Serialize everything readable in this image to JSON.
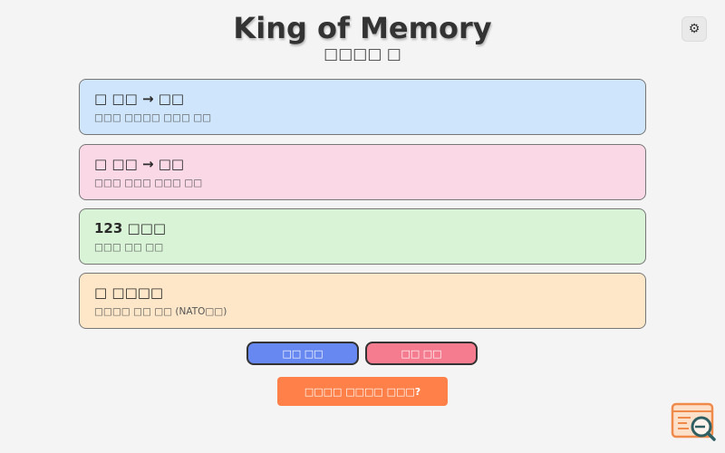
{
  "header": {
    "title": "King of Memory",
    "subtitle": "□□□□ □",
    "settings_icon": "⚙"
  },
  "cards": [
    {
      "title": "□ □□ → □□",
      "desc": "□□□ □□□□ □□□ □□"
    },
    {
      "title": "□ □□ → □□",
      "desc": "□□□ □□□ □□□ □□"
    },
    {
      "title": "123 □□□",
      "desc": "□□□ □□ □□"
    },
    {
      "title": "□ □□□□",
      "desc": "□□□□ □□ □□ (NATO□□)"
    }
  ],
  "buttons": {
    "blue_label": "□□ □□",
    "pink_label": "□□ □□",
    "orange_label": "□□□□ □□□□ □□□?"
  },
  "colors": {
    "card1": "#cfe5fb",
    "card2": "#fbd8e6",
    "card3": "#d9f3d6",
    "card4": "#fde7c8",
    "blue_button": "#6688f0",
    "pink_button": "#f57b8f",
    "orange_button": "#ff8149"
  }
}
